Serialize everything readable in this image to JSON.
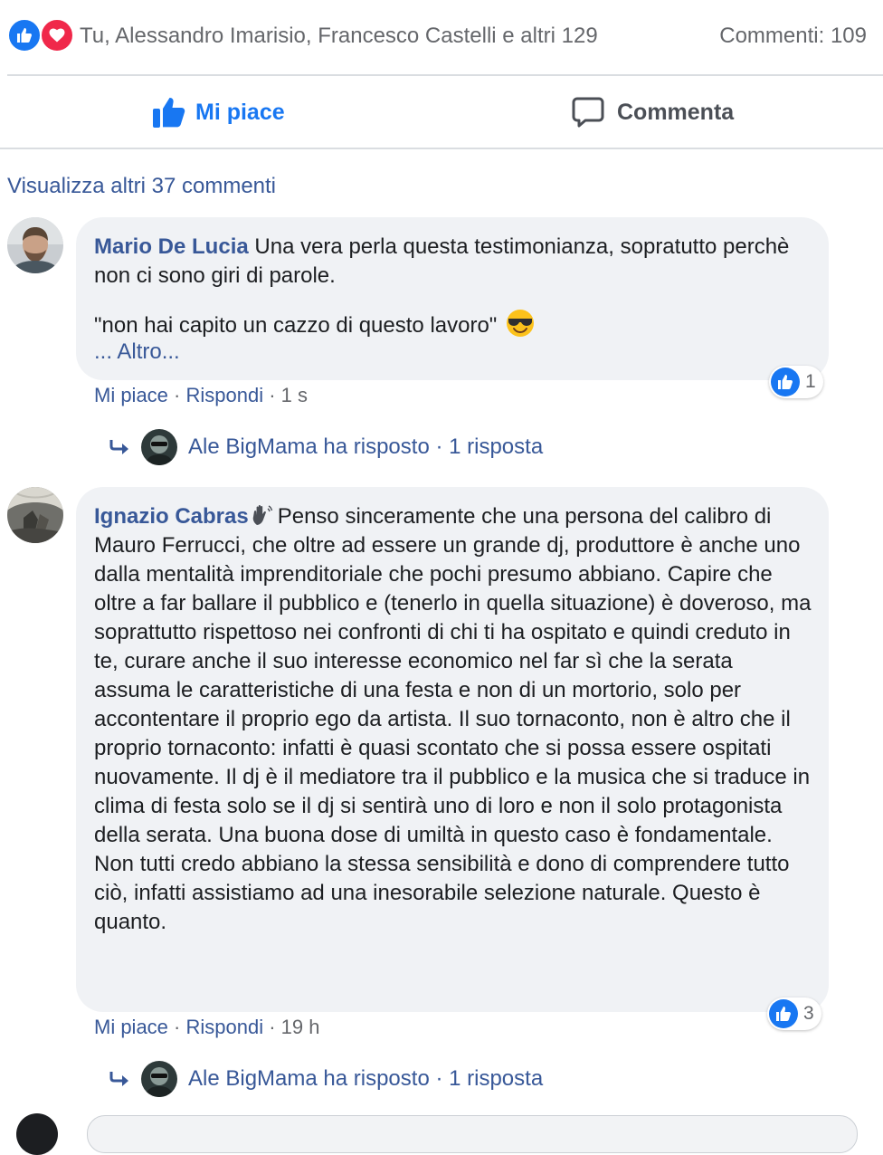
{
  "reactions": {
    "icons": [
      "like-icon",
      "love-icon"
    ],
    "people_text": "Tu, Alessandro Imarisio, Francesco Castelli e altri 129",
    "comment_count": "Commenti: 109"
  },
  "actions": {
    "like_label": "Mi piace",
    "comment_label": "Commenta"
  },
  "more_comments": "Visualizza altri 37 commenti",
  "comments": [
    {
      "author": "Mario De Lucia",
      "text_line1": "Una vera perla questa testimonianza, sopratutto perchè non ci sono giri di parole.",
      "text_line2": "\"non hai capito un cazzo di questo lavoro\"",
      "more": "... Altro...",
      "emoji": "sunglasses-emoji",
      "reaction_count": "1",
      "meta": {
        "like": "Mi piace",
        "reply": "Rispondi",
        "time": "1 s"
      },
      "reply": {
        "text": "Ale BigMama ha risposto · 1 risposta"
      }
    },
    {
      "author": "Ignazio Cabras",
      "author_icon": "wave-hand-icon",
      "text": "Penso sinceramente che una persona del calibro di Mauro Ferrucci, che oltre ad essere un grande dj, produttore è anche uno dalla mentalità imprenditoriale che pochi presumo abbiano. Capire che oltre a far ballare il pubblico e (tenerlo in quella situazione) è doveroso, ma soprattutto rispettoso nei confronti di chi ti ha ospitato e quindi creduto in te, curare anche il suo interesse economico nel far sì che la serata assuma le caratteristiche di una festa e non di un mortorio, solo per accontentare il proprio ego da artista. Il suo tornaconto, non è altro che il proprio tornaconto: infatti è quasi scontato che si possa essere ospitati nuovamente. Il dj è il mediatore tra il pubblico e la musica che si traduce in clima di festa solo se il dj si sentirà uno di loro e non il solo protagonista della serata. Una buona dose di umiltà in questo caso è fondamentale. Non tutti credo abbiano la stessa sensibilità e dono di comprendere tutto ciò, infatti assistiamo ad una inesorabile selezione naturale. Questo è quanto.",
      "reaction_count": "3",
      "meta": {
        "like": "Mi piace",
        "reply": "Rispondi",
        "time": "19 h"
      },
      "reply": {
        "text": "Ale BigMama ha risposto · 1 risposta"
      }
    }
  ],
  "colors": {
    "link": "#385898",
    "facebook_blue": "#1877f2",
    "love_red": "#f0284a",
    "bubble_bg": "#f0f2f5",
    "muted_text": "#65676b"
  }
}
